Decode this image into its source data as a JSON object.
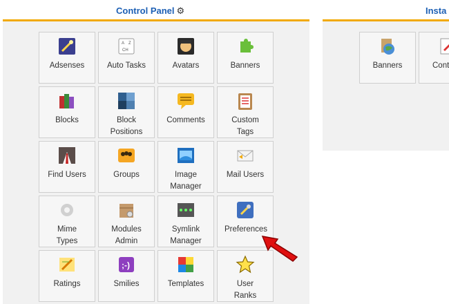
{
  "control_panel": {
    "title": "Control Panel",
    "tiles": [
      {
        "label": "Adsenses",
        "icon": "magic-wand-icon"
      },
      {
        "label": "Auto Tasks",
        "icon": "keyboard-icon"
      },
      {
        "label": "Avatars",
        "icon": "avatar-icon"
      },
      {
        "label": "Banners",
        "icon": "puzzle-piece-icon"
      },
      {
        "label": "Blocks",
        "icon": "blocks-icon"
      },
      {
        "label": "Block Positions",
        "icon": "block-positions-icon"
      },
      {
        "label": "Comments",
        "icon": "comment-bubble-icon"
      },
      {
        "label": "Custom Tags",
        "icon": "clipboard-icon"
      },
      {
        "label": "Find Users",
        "icon": "user-suit-icon"
      },
      {
        "label": "Groups",
        "icon": "group-icon"
      },
      {
        "label": "Image Manager",
        "icon": "image-icon"
      },
      {
        "label": "Mail Users",
        "icon": "mail-icon"
      },
      {
        "label": "Mime Types",
        "icon": "mime-gear-icon"
      },
      {
        "label": "Modules Admin",
        "icon": "modules-box-icon"
      },
      {
        "label": "Symlink Manager",
        "icon": "symlink-icon"
      },
      {
        "label": "Preferences",
        "icon": "wrench-icon"
      },
      {
        "label": "Ratings",
        "icon": "pencil-note-icon"
      },
      {
        "label": "Smilies",
        "icon": "smiley-icon"
      },
      {
        "label": "Templates",
        "icon": "color-palette-icon"
      },
      {
        "label": "User Ranks",
        "icon": "star-icon"
      }
    ]
  },
  "installed_modules": {
    "title": "Insta",
    "tiles": [
      {
        "label": "Banners",
        "icon": "banners-module-icon"
      },
      {
        "label": "Cont",
        "icon": "contact-module-icon"
      }
    ]
  },
  "annotation": {
    "icon": "red-arrow-icon"
  }
}
